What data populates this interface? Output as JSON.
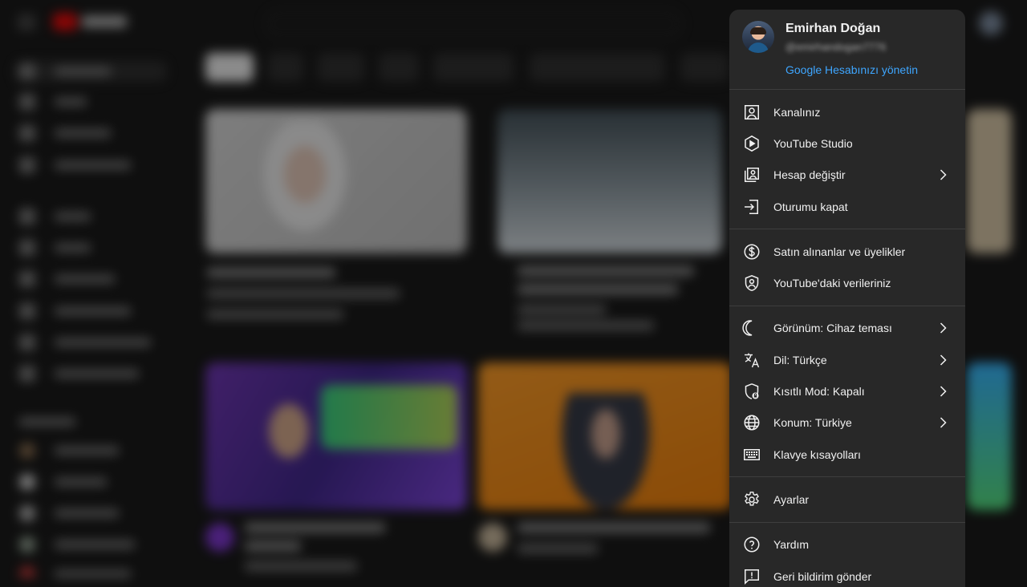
{
  "account": {
    "name": "Emirhan Doğan",
    "handle": "@emirhandogan7776",
    "manage_link": "Google Hesabınızı yönetin"
  },
  "menu": {
    "section1": [
      {
        "label": "Kanalınız",
        "icon": "person-box-icon"
      },
      {
        "label": "YouTube Studio",
        "icon": "studio-icon"
      },
      {
        "label": "Hesap değiştir",
        "icon": "switch-account-icon",
        "chevron": true
      },
      {
        "label": "Oturumu kapat",
        "icon": "sign-out-icon"
      }
    ],
    "section2": [
      {
        "label": "Satın alınanlar ve üyelikler",
        "icon": "dollar-icon"
      },
      {
        "label": "YouTube'daki verileriniz",
        "icon": "shield-person-icon"
      }
    ],
    "section3": [
      {
        "label": "Görünüm: Cihaz teması",
        "icon": "moon-icon",
        "chevron": true
      },
      {
        "label": "Dil: Türkçe",
        "icon": "translate-icon",
        "chevron": true
      },
      {
        "label": "Kısıtlı Mod: Kapalı",
        "icon": "restricted-icon",
        "chevron": true
      },
      {
        "label": "Konum: Türkiye",
        "icon": "globe-icon",
        "chevron": true
      },
      {
        "label": "Klavye kısayolları",
        "icon": "keyboard-icon"
      }
    ],
    "section4": [
      {
        "label": "Ayarlar",
        "icon": "gear-icon"
      }
    ],
    "section5": [
      {
        "label": "Yardım",
        "icon": "help-icon"
      },
      {
        "label": "Geri bildirim gönder",
        "icon": "feedback-icon"
      }
    ]
  },
  "colors": {
    "menu_bg": "#282828",
    "link": "#3ea6ff",
    "page_bg": "#0f0f0f",
    "brand": "#ff0000"
  }
}
